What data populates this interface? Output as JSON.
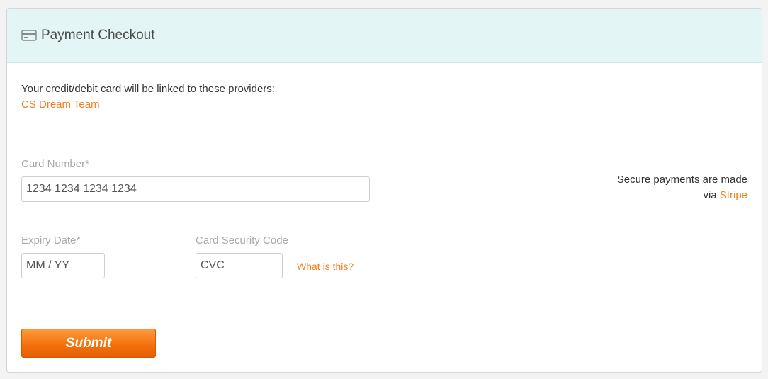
{
  "header": {
    "title": "Payment Checkout",
    "icon": "credit-card-icon"
  },
  "providers": {
    "intro": "Your credit/debit card will be linked to these providers:",
    "items": [
      "CS Dream Team"
    ]
  },
  "form": {
    "card_number": {
      "label": "Card Number*",
      "placeholder": "1234 1234 1234 1234"
    },
    "expiry": {
      "label": "Expiry Date*",
      "placeholder": "MM / YY"
    },
    "cvc": {
      "label": "Card Security Code",
      "placeholder": "CVC",
      "help_link": "What is this?"
    },
    "submit_label": "Submit"
  },
  "secure": {
    "line1": "Secure payments are made",
    "via": "via",
    "provider": "Stripe"
  },
  "colors": {
    "accent": "#f08020",
    "header_bg": "#e3f5f4",
    "button": "#f26f0a"
  }
}
